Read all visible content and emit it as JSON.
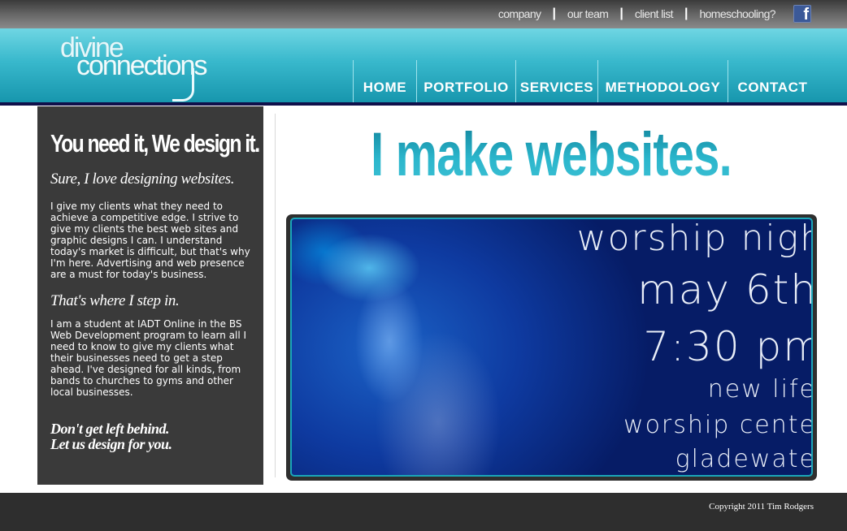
{
  "top_links": [
    "company",
    "our team",
    "client list",
    "homeschooling?"
  ],
  "top_separator": "|",
  "social": {
    "icon": "facebook-icon",
    "glyph": "f"
  },
  "logo": {
    "line1": "divine",
    "line2": "connections"
  },
  "nav": [
    "HOME",
    "PORTFOLIO",
    "SERVICES",
    "METHODOLOGY",
    "CONTACT"
  ],
  "sidebar": {
    "title": "You need it, We design it.",
    "subtitle": "Sure, I love designing websites.",
    "para1": "I give my clients what they need to achieve a competitive edge.  I strive to give my clients the best web sites and graphic designs I can.  I understand today's market is difficult, but that's why I'm here.  Advertising and web presence are a must for today's business.",
    "heading2": "That's where I step in.",
    "para2": "I am a student at IADT Online in the BS Web Development program to learn all I need to know to give my clients what their businesses need to get a step ahead.  I've designed for all kinds, from bands to churches to gyms and other local businesses.",
    "cta_line1": "Don't get left behind.",
    "cta_line2": "Let us design for you."
  },
  "hero_title": "I make websites.",
  "banner": {
    "line1": "worship nigh",
    "line2": "may 6th",
    "line3": "7:30 pm",
    "line4": "new life",
    "line5": "worship cente",
    "line6": "gladewate"
  },
  "footer": {
    "copyright": "Copyright 2011 Tim Rodgers"
  },
  "colors": {
    "accent": "#38b8cc",
    "dark": "#3a3a3a",
    "navy": "#10104a"
  }
}
